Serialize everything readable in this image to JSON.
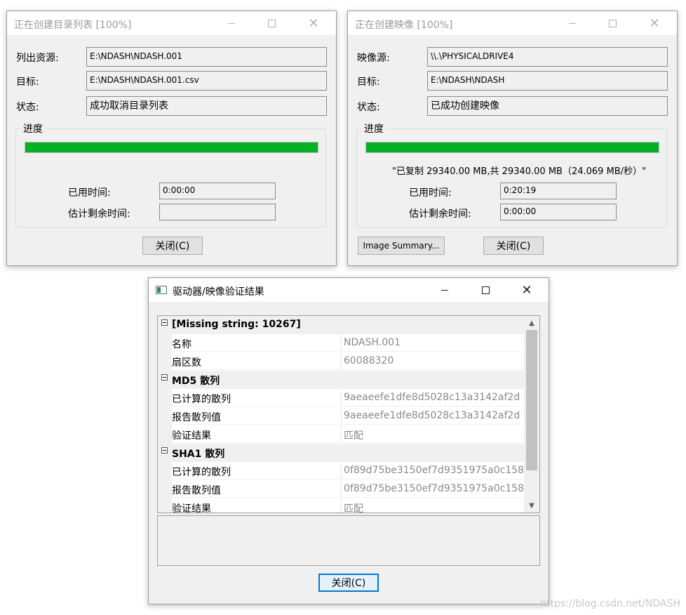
{
  "dialog1": {
    "title": "正在创建目录列表 [100%]",
    "source_label": "列出资源:",
    "source_value": "E:\\NDASH\\NDASH.001",
    "target_label": "目标:",
    "target_value": "E:\\NDASH\\NDASH.001.csv",
    "status_label": "状态:",
    "status_value": "成功取消目录列表",
    "group_caption": "进度",
    "progress_fraction": 1.0,
    "elapsed_label": "已用时间:",
    "elapsed_value": "0:00:00",
    "remaining_label": "估计剩余时间:",
    "remaining_value": "",
    "close_button": "关闭(C)"
  },
  "dialog2": {
    "title": "正在创建映像 [100%]",
    "source_label": "映像源:",
    "source_value": "\\\\.\\PHYSICALDRIVE4",
    "target_label": "目标:",
    "target_value": "E:\\NDASH\\NDASH",
    "status_label": "状态:",
    "status_value": "已成功创建映像",
    "group_caption": "进度",
    "progress_fraction": 1.0,
    "copied_text": "\"已复制 29340.00 MB,共 29340.00 MB（24.069 MB/秒）\"",
    "elapsed_label": "已用时间:",
    "elapsed_value": "0:20:19",
    "remaining_label": "估计剩余时间:",
    "remaining_value": "0:00:00",
    "summary_button": "Image Summary...",
    "close_button": "关闭(C)"
  },
  "dialog3": {
    "title": "驱动器/映像验证结果",
    "sections": [
      {
        "label": "[Missing string: 10267]",
        "rows": [
          {
            "name": "名称",
            "value": "NDASH.001"
          },
          {
            "name": "扇区数",
            "value": "60088320"
          }
        ]
      },
      {
        "label": "MD5 散列",
        "rows": [
          {
            "name": "已计算的散列",
            "value": "9aeaeefe1dfe8d5028c13a3142af2d"
          },
          {
            "name": "报告散列值",
            "value": "9aeaeefe1dfe8d5028c13a3142af2d"
          },
          {
            "name": "验证结果",
            "value": "匹配"
          }
        ]
      },
      {
        "label": "SHA1 散列",
        "rows": [
          {
            "name": "已计算的散列",
            "value": "0f89d75be3150ef7d9351975a0c158"
          },
          {
            "name": "报告散列值",
            "value": "0f89d75be3150ef7d9351975a0c158"
          },
          {
            "name": "验证结果",
            "value": "匹配"
          }
        ]
      }
    ],
    "close_button": "关闭(C)"
  },
  "icons": {
    "minimize": "minimize-icon",
    "maximize": "maximize-icon",
    "close": "close-icon",
    "expander": "collapse-icon",
    "scroll_up": "chevron-up-icon",
    "scroll_down": "chevron-down-icon"
  },
  "colors": {
    "progress": "#06b025",
    "default_button_border": "#0078d7"
  },
  "watermark": "https://blog.csdn.net/NDASH"
}
